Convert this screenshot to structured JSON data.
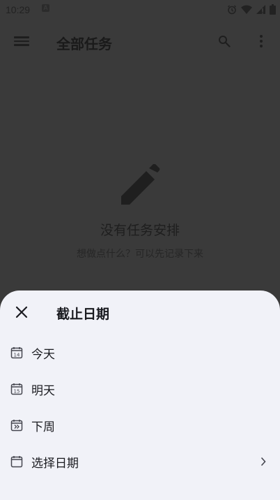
{
  "status_bar": {
    "time": "10:29",
    "a_badge": "A"
  },
  "app_bar": {
    "title": "全部任务"
  },
  "empty_state": {
    "title": "没有任务安排",
    "subtitle": "想做点什么？可以先记录下来"
  },
  "sheet": {
    "title": "截止日期",
    "options": [
      {
        "label": "今天",
        "icon": "calendar-today-icon",
        "day": "14"
      },
      {
        "label": "明天",
        "icon": "calendar-tomorrow-icon",
        "day": "15"
      },
      {
        "label": "下周",
        "icon": "calendar-next-week-icon"
      },
      {
        "label": "选择日期",
        "icon": "calendar-icon"
      }
    ]
  },
  "colors": {
    "scrim_bg": "#3a3a3a",
    "sheet_bg": "#f1f2f8",
    "text": "#1a1b20"
  }
}
